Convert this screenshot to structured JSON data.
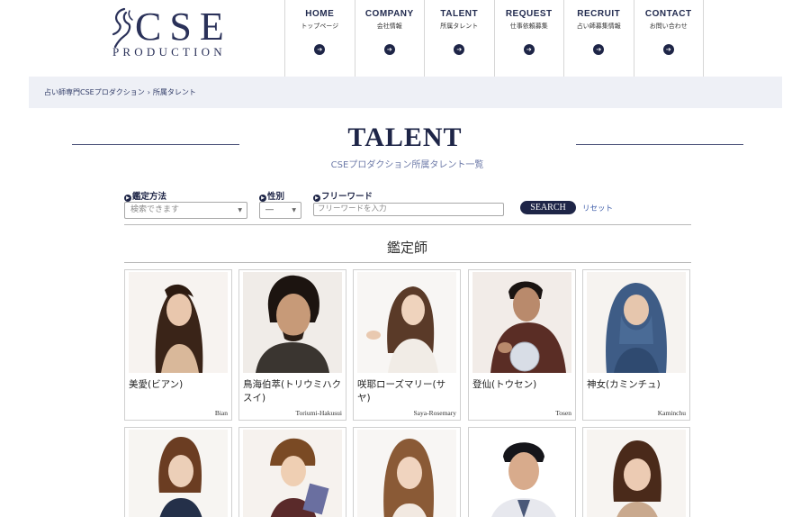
{
  "logo": {
    "main": "CSE",
    "sub": "PRODUCTION"
  },
  "nav": [
    {
      "en": "HOME",
      "ja": "トップページ"
    },
    {
      "en": "COMPANY",
      "ja": "会社情報"
    },
    {
      "en": "TALENT",
      "ja": "所属タレント"
    },
    {
      "en": "REQUEST",
      "ja": "仕事依頼募集"
    },
    {
      "en": "RECRUIT",
      "ja": "占い師募集情報"
    },
    {
      "en": "CONTACT",
      "ja": "お問い合わせ"
    }
  ],
  "breadcrumb": {
    "home": "占い師専門CSEプロダクション",
    "separator": "›",
    "current": "所属タレント"
  },
  "page": {
    "title": "TALENT",
    "subtitle": "CSEプロダクション所属タレント一覧"
  },
  "search": {
    "method_label": "鑑定方法",
    "method_placeholder": "検索できます",
    "gender_label": "性別",
    "gender_value": "―",
    "keyword_label": "フリーワード",
    "keyword_placeholder": "フリーワードを入力",
    "search_button": "SEARCH",
    "reset_link": "リセット"
  },
  "section": {
    "title": "鑑定師"
  },
  "talents": [
    {
      "name_ja": "美愛(ビアン)",
      "name_en": "Bian"
    },
    {
      "name_ja": "鳥海伯萃(トリウミハクスイ)",
      "name_en": "Toriumi-Hakusui"
    },
    {
      "name_ja": "咲耶ローズマリー(サヤ)",
      "name_en": "Saya-Rosemary"
    },
    {
      "name_ja": "登仙(トウセン)",
      "name_en": "Tosen"
    },
    {
      "name_ja": "神女(カミンチュ)",
      "name_en": "Kaminchu"
    },
    {
      "name_ja": "",
      "name_en": ""
    },
    {
      "name_ja": "",
      "name_en": ""
    },
    {
      "name_ja": "",
      "name_en": ""
    },
    {
      "name_ja": "",
      "name_en": ""
    },
    {
      "name_ja": "",
      "name_en": ""
    }
  ],
  "colors": {
    "navy": "#1e2547",
    "breadcrumb_bg": "#eef0f6",
    "subtitle": "#6d7aa8",
    "link": "#3b5aa8"
  }
}
